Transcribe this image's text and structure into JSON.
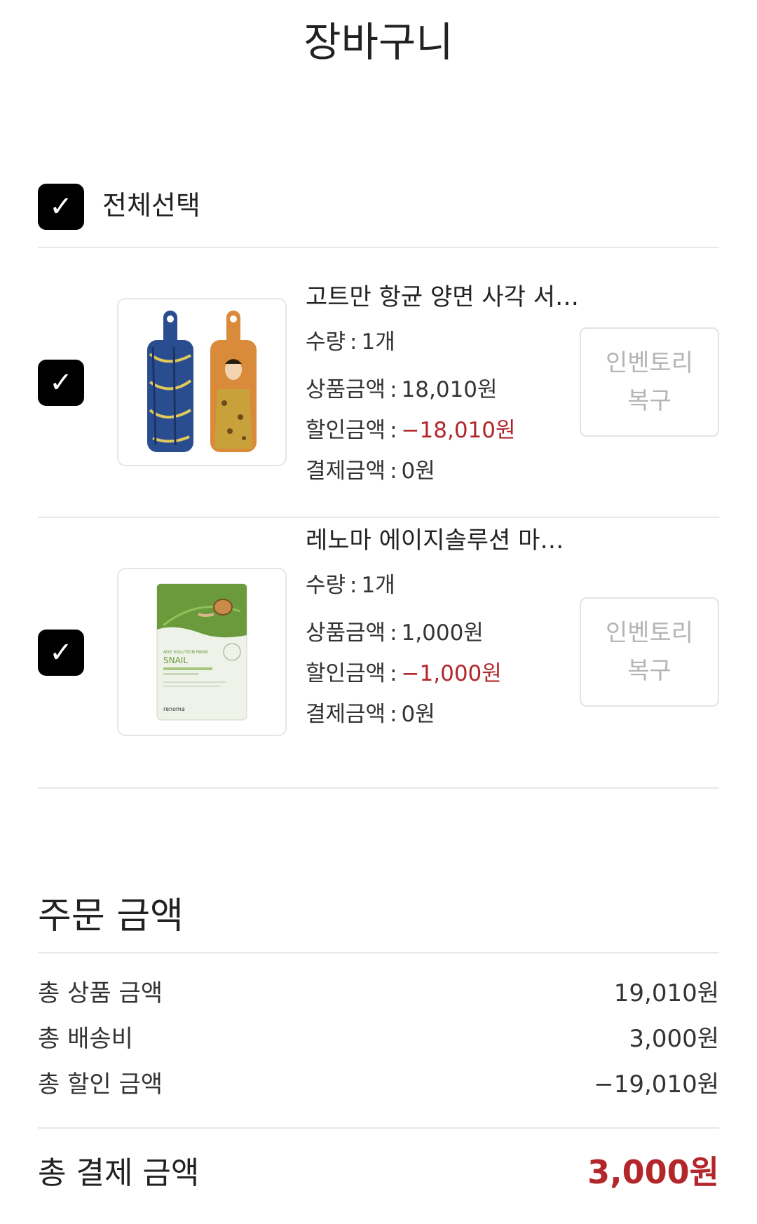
{
  "header": {
    "title": "장바구니"
  },
  "select_all": {
    "checkmark": "✓",
    "label": "전체선택",
    "checked": true
  },
  "items": [
    {
      "checked": true,
      "checkmark": "✓",
      "name": "고트만 항균 양면 사각 서…",
      "quantity_label": "수량",
      "quantity_value": "1개",
      "price_label": "상품금액",
      "price_value": "18,010원",
      "discount_label": "할인금액",
      "discount_value": "−18,010원",
      "payment_label": "결제금액",
      "payment_value": "0원",
      "restore_line1": "인벤토리",
      "restore_line2": "복구",
      "colors": {
        "left_board": "#2a4d8f",
        "right_board": "#d98a3a"
      }
    },
    {
      "checked": true,
      "checkmark": "✓",
      "name": "레노마 에이지솔루션 마…",
      "quantity_label": "수량",
      "quantity_value": "1개",
      "price_label": "상품금액",
      "price_value": "1,000원",
      "discount_label": "할인금액",
      "discount_value": "−1,000원",
      "payment_label": "결제금액",
      "payment_value": "0원",
      "restore_line1": "인벤토리",
      "restore_line2": "복구",
      "pack_text": {
        "subtitle": "AGE SOLUTION MASK",
        "name": "SNAIL",
        "brand": "renoma"
      },
      "colors": {
        "leaf": "#6a9a3c",
        "pack": "#eef2e8"
      }
    }
  ],
  "summary": {
    "title": "주문 금액",
    "rows": [
      {
        "label": "총 상품 금액",
        "value": "19,010원"
      },
      {
        "label": "총 배송비",
        "value": "3,000원"
      },
      {
        "label": "총 할인 금액",
        "value": "−19,010원"
      }
    ],
    "total_label": "총 결제 금액",
    "total_value": "3,000원"
  },
  "colors": {
    "accent_red": "#b3262a",
    "checkbox": "#000000"
  }
}
